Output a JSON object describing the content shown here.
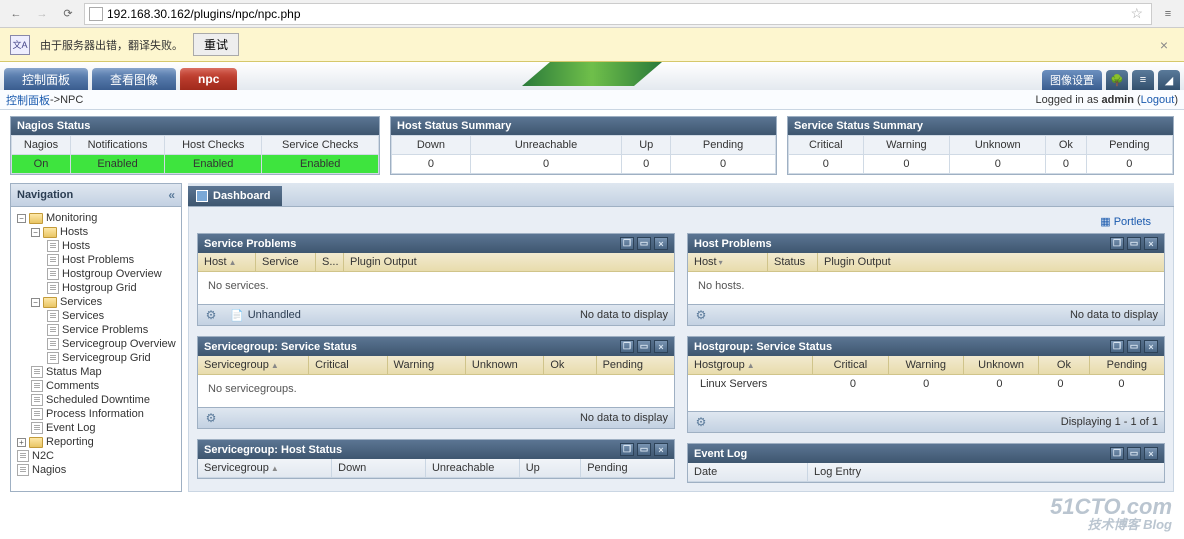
{
  "chrome": {
    "url": "192.168.30.162/plugins/npc/npc.php"
  },
  "translate": {
    "message": "由于服务器出错，翻译失败。",
    "retry": "重试"
  },
  "tabs": {
    "control_panel": "控制面板",
    "view_image": "查看图像",
    "npc": "npc",
    "image_settings": "图像设置"
  },
  "breadcrumb": {
    "root": "控制面板",
    "sep": " -> ",
    "leaf": "NPC",
    "logged_prefix": "Logged in as ",
    "user": "admin",
    "logout": "Logout"
  },
  "nagios_status": {
    "title": "Nagios Status",
    "headers": [
      "Nagios",
      "Notifications",
      "Host Checks",
      "Service Checks"
    ],
    "values": [
      "On",
      "Enabled",
      "Enabled",
      "Enabled"
    ]
  },
  "host_summary": {
    "title": "Host Status Summary",
    "headers": [
      "Down",
      "Unreachable",
      "Up",
      "Pending"
    ],
    "values": [
      "0",
      "0",
      "0",
      "0"
    ]
  },
  "service_summary": {
    "title": "Service Status Summary",
    "headers": [
      "Critical",
      "Warning",
      "Unknown",
      "Ok",
      "Pending"
    ],
    "values": [
      "0",
      "0",
      "0",
      "0",
      "0"
    ]
  },
  "nav": {
    "title": "Navigation",
    "monitoring": "Monitoring",
    "hosts_folder": "Hosts",
    "hosts": "Hosts",
    "host_problems": "Host Problems",
    "hostgroup_overview": "Hostgroup Overview",
    "hostgroup_grid": "Hostgroup Grid",
    "services_folder": "Services",
    "services": "Services",
    "service_problems": "Service Problems",
    "servicegroup_overview": "Servicegroup Overview",
    "servicegroup_grid": "Servicegroup Grid",
    "status_map": "Status Map",
    "comments": "Comments",
    "scheduled_downtime": "Scheduled Downtime",
    "process_info": "Process Information",
    "event_log": "Event Log",
    "reporting": "Reporting",
    "n2c": "N2C",
    "nagios": "Nagios"
  },
  "dashboard": {
    "tab": "Dashboard",
    "portlets_link": "Portlets",
    "no_data": "No data to display",
    "unhandled": "Unhandled"
  },
  "sp": {
    "title": "Service Problems",
    "cols": [
      "Host",
      "Service",
      "S...",
      "Plugin Output"
    ],
    "empty": "No services."
  },
  "hp": {
    "title": "Host Problems",
    "cols": [
      "Host",
      "Status",
      "Plugin Output"
    ],
    "empty": "No hosts."
  },
  "sgss": {
    "title": "Servicegroup: Service Status",
    "cols": [
      "Servicegroup",
      "Critical",
      "Warning",
      "Unknown",
      "Ok",
      "Pending"
    ],
    "empty": "No servicegroups."
  },
  "hgss": {
    "title": "Hostgroup: Service Status",
    "cols": [
      "Hostgroup",
      "Critical",
      "Warning",
      "Unknown",
      "Ok",
      "Pending"
    ],
    "row": [
      "Linux Servers",
      "0",
      "0",
      "0",
      "0",
      "0"
    ],
    "paging": "Displaying 1 - 1 of 1"
  },
  "sghs": {
    "title": "Servicegroup: Host Status",
    "cols": [
      "Servicegroup",
      "Down",
      "Unreachable",
      "Up",
      "Pending"
    ]
  },
  "eventlog": {
    "title": "Event Log",
    "cols": [
      "Date",
      "Log Entry"
    ]
  },
  "watermark": {
    "main": "51CTO.com",
    "sub": "技术博客  Blog"
  }
}
